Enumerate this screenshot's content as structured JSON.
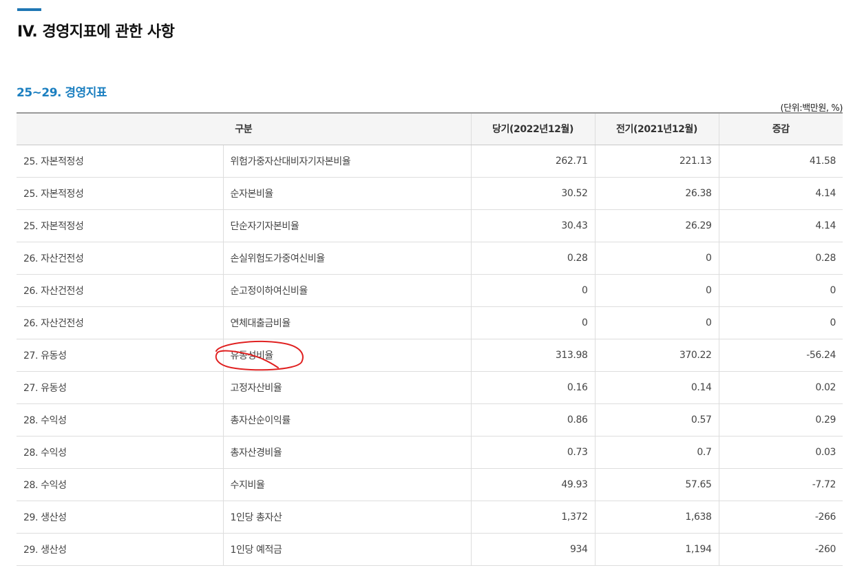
{
  "page": {
    "title": "IV. 경영지표에 관한 사항"
  },
  "section": {
    "title": "25~29. 경영지표",
    "unit_note": "(단위:백만원, %)"
  },
  "table": {
    "headers": {
      "category": "구분",
      "current": "당기(2022년12월)",
      "previous": "전기(2021년12월)",
      "change": "증감"
    },
    "rows": [
      {
        "category": "25. 자본적정성",
        "item": "위험가중자산대비자기자본비율",
        "current": "262.71",
        "previous": "221.13",
        "change": "41.58"
      },
      {
        "category": "25. 자본적정성",
        "item": "순자본비율",
        "current": "30.52",
        "previous": "26.38",
        "change": "4.14"
      },
      {
        "category": "25. 자본적정성",
        "item": "단순자기자본비율",
        "current": "30.43",
        "previous": "26.29",
        "change": "4.14"
      },
      {
        "category": "26. 자산건전성",
        "item": "손실위험도가중여신비율",
        "current": "0.28",
        "previous": "0",
        "change": "0.28"
      },
      {
        "category": "26. 자산건전성",
        "item": "순고정이하여신비율",
        "current": "0",
        "previous": "0",
        "change": "0"
      },
      {
        "category": "26. 자산건전성",
        "item": "연체대출금비율",
        "current": "0",
        "previous": "0",
        "change": "0"
      },
      {
        "category": "27. 유동성",
        "item": "유동성비율",
        "current": "313.98",
        "previous": "370.22",
        "change": "-56.24"
      },
      {
        "category": "27. 유동성",
        "item": "고정자산비율",
        "current": "0.16",
        "previous": "0.14",
        "change": "0.02"
      },
      {
        "category": "28. 수익성",
        "item": "총자산순이익률",
        "current": "0.86",
        "previous": "0.57",
        "change": "0.29"
      },
      {
        "category": "28. 수익성",
        "item": "총자산경비율",
        "current": "0.73",
        "previous": "0.7",
        "change": "0.03"
      },
      {
        "category": "28. 수익성",
        "item": "수지비율",
        "current": "49.93",
        "previous": "57.65",
        "change": "-7.72"
      },
      {
        "category": "29. 생산성",
        "item": "1인당 총자산",
        "current": "1,372",
        "previous": "1,638",
        "change": "-266"
      },
      {
        "category": "29. 생산성",
        "item": "1인당 예적금",
        "current": "934",
        "previous": "1,194",
        "change": "-260"
      }
    ]
  },
  "colors": {
    "accent": "#1f77b4",
    "section_title": "#1b7fc0",
    "header_bg": "#f5f5f5",
    "annotation": "#e02020"
  }
}
